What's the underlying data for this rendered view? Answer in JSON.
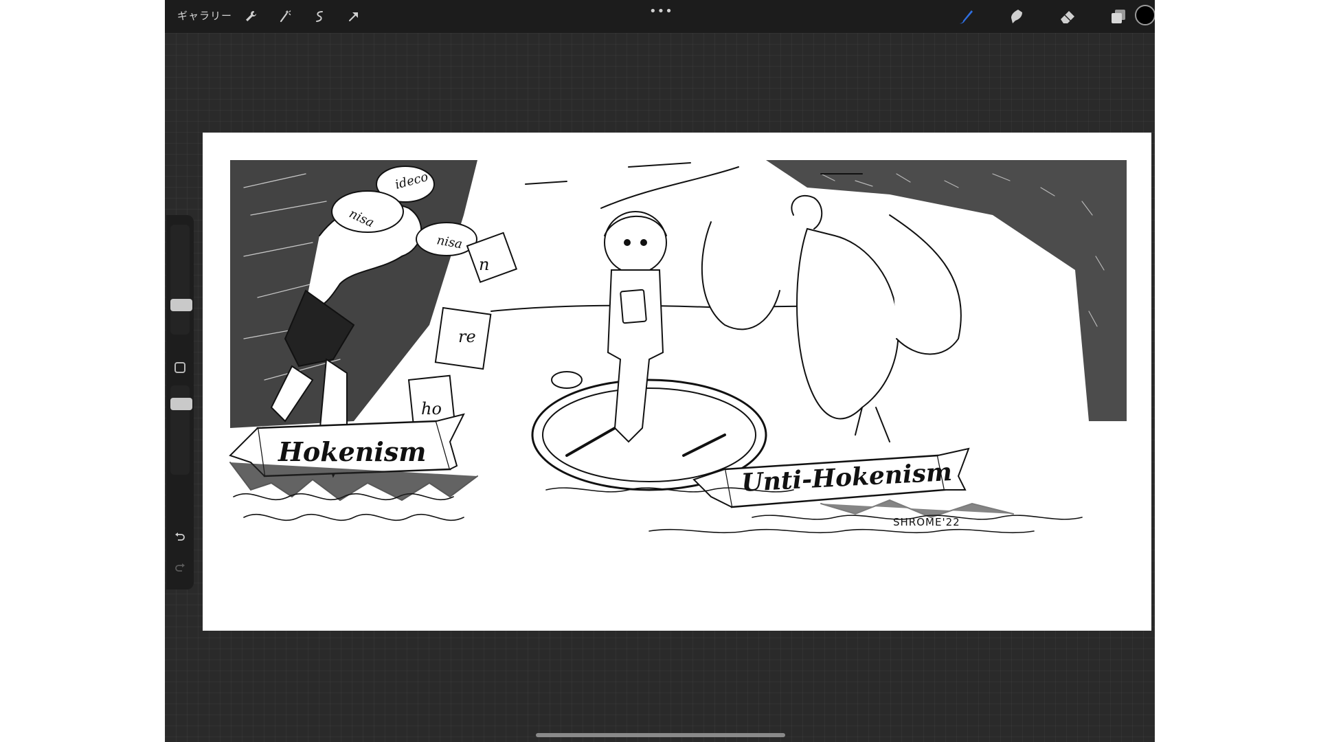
{
  "toolbar": {
    "gallery_label": "ギャラリー",
    "more_label": "•••",
    "left_tools": [
      "wrench-icon",
      "magic-wand-icon",
      "selection-icon",
      "transform-arrow-icon"
    ],
    "right_tools": [
      "brush-icon",
      "smudge-icon",
      "eraser-icon",
      "layers-icon"
    ],
    "active_color": "#000000",
    "accent_color": "#2f6fe0"
  },
  "sidebar": {
    "brush_size_level": 0.38,
    "opacity_level": 0.25
  },
  "canvas": {
    "banner_left": "Hokenism",
    "banner_right": "Unti-Hokenism",
    "hat_words": [
      "ideco",
      "nisa",
      "nisa"
    ],
    "card_letters": [
      "n",
      "re",
      "ho"
    ],
    "signature": "SHROME'22"
  }
}
